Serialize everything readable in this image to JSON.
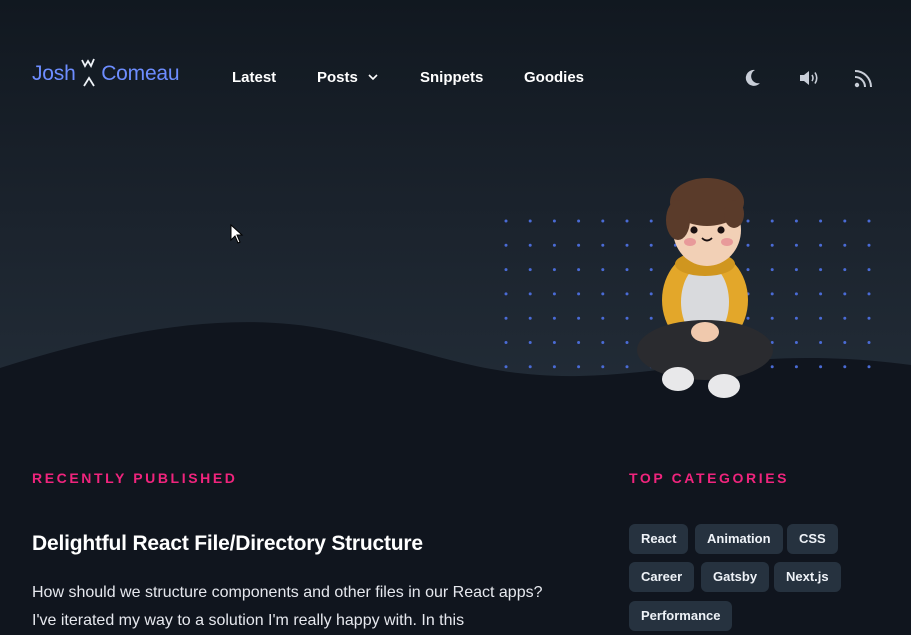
{
  "header": {
    "logo": {
      "first": "Josh",
      "second": "Comeau"
    },
    "nav": [
      {
        "label": "Latest"
      },
      {
        "label": "Posts"
      },
      {
        "label": "Snippets"
      },
      {
        "label": "Goodies"
      }
    ],
    "tools": [
      {
        "icon": "moon-icon"
      },
      {
        "icon": "sound-icon"
      },
      {
        "icon": "rss-icon"
      }
    ]
  },
  "recent": {
    "heading": "RECENTLY PUBLISHED",
    "post": {
      "title": "Delightful React File/Directory Structure",
      "excerpt": "How should we structure components and other files in our React apps? I've iterated my way to a solution I'm really happy with. In this"
    }
  },
  "categories": {
    "heading": "TOP CATEGORIES",
    "tags": [
      "React",
      "Animation",
      "CSS",
      "Career",
      "Gatsby",
      "Next.js",
      "Performance"
    ]
  },
  "colors": {
    "background": "#10151e",
    "accent_pink": "#f0247d",
    "logo_blue": "#6d8dff",
    "tag_bg": "#26323f"
  }
}
